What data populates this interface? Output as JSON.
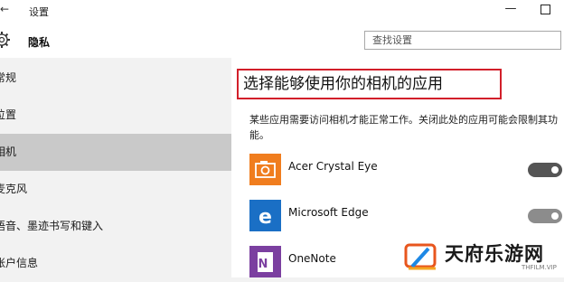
{
  "window": {
    "title": "设置",
    "back_glyph": "←",
    "minimize_glyph": "—"
  },
  "header": {
    "section": "隐私",
    "search_placeholder": "查找设置"
  },
  "sidebar": {
    "items": [
      {
        "label": "常规"
      },
      {
        "label": "位置"
      },
      {
        "label": "相机",
        "active": true
      },
      {
        "label": "麦克风"
      },
      {
        "label": "语音、墨迹书写和键入"
      },
      {
        "label": "帐户信息"
      }
    ]
  },
  "main": {
    "heading": "选择能够使用你的相机的应用",
    "description": "某些应用需要访问相机才能正常工作。关闭此处的应用可能会限制其功能。",
    "apps": [
      {
        "name": "Acer Crystal Eye",
        "icon": "camera-app-icon",
        "color": "#f07d1e",
        "toggle": "on"
      },
      {
        "name": "Microsoft Edge",
        "icon": "edge-icon",
        "color": "#1a6fc5",
        "toggle": "on"
      },
      {
        "name": "OneNote",
        "icon": "onenote-icon",
        "color": "#7b3fa0",
        "toggle": "on"
      }
    ]
  },
  "watermark": {
    "text": "天府乐游网",
    "subtext": "THFILM.VIP"
  },
  "colors": {
    "highlight_border": "#d21f2a",
    "sidebar_active": "#c9c9c9"
  }
}
